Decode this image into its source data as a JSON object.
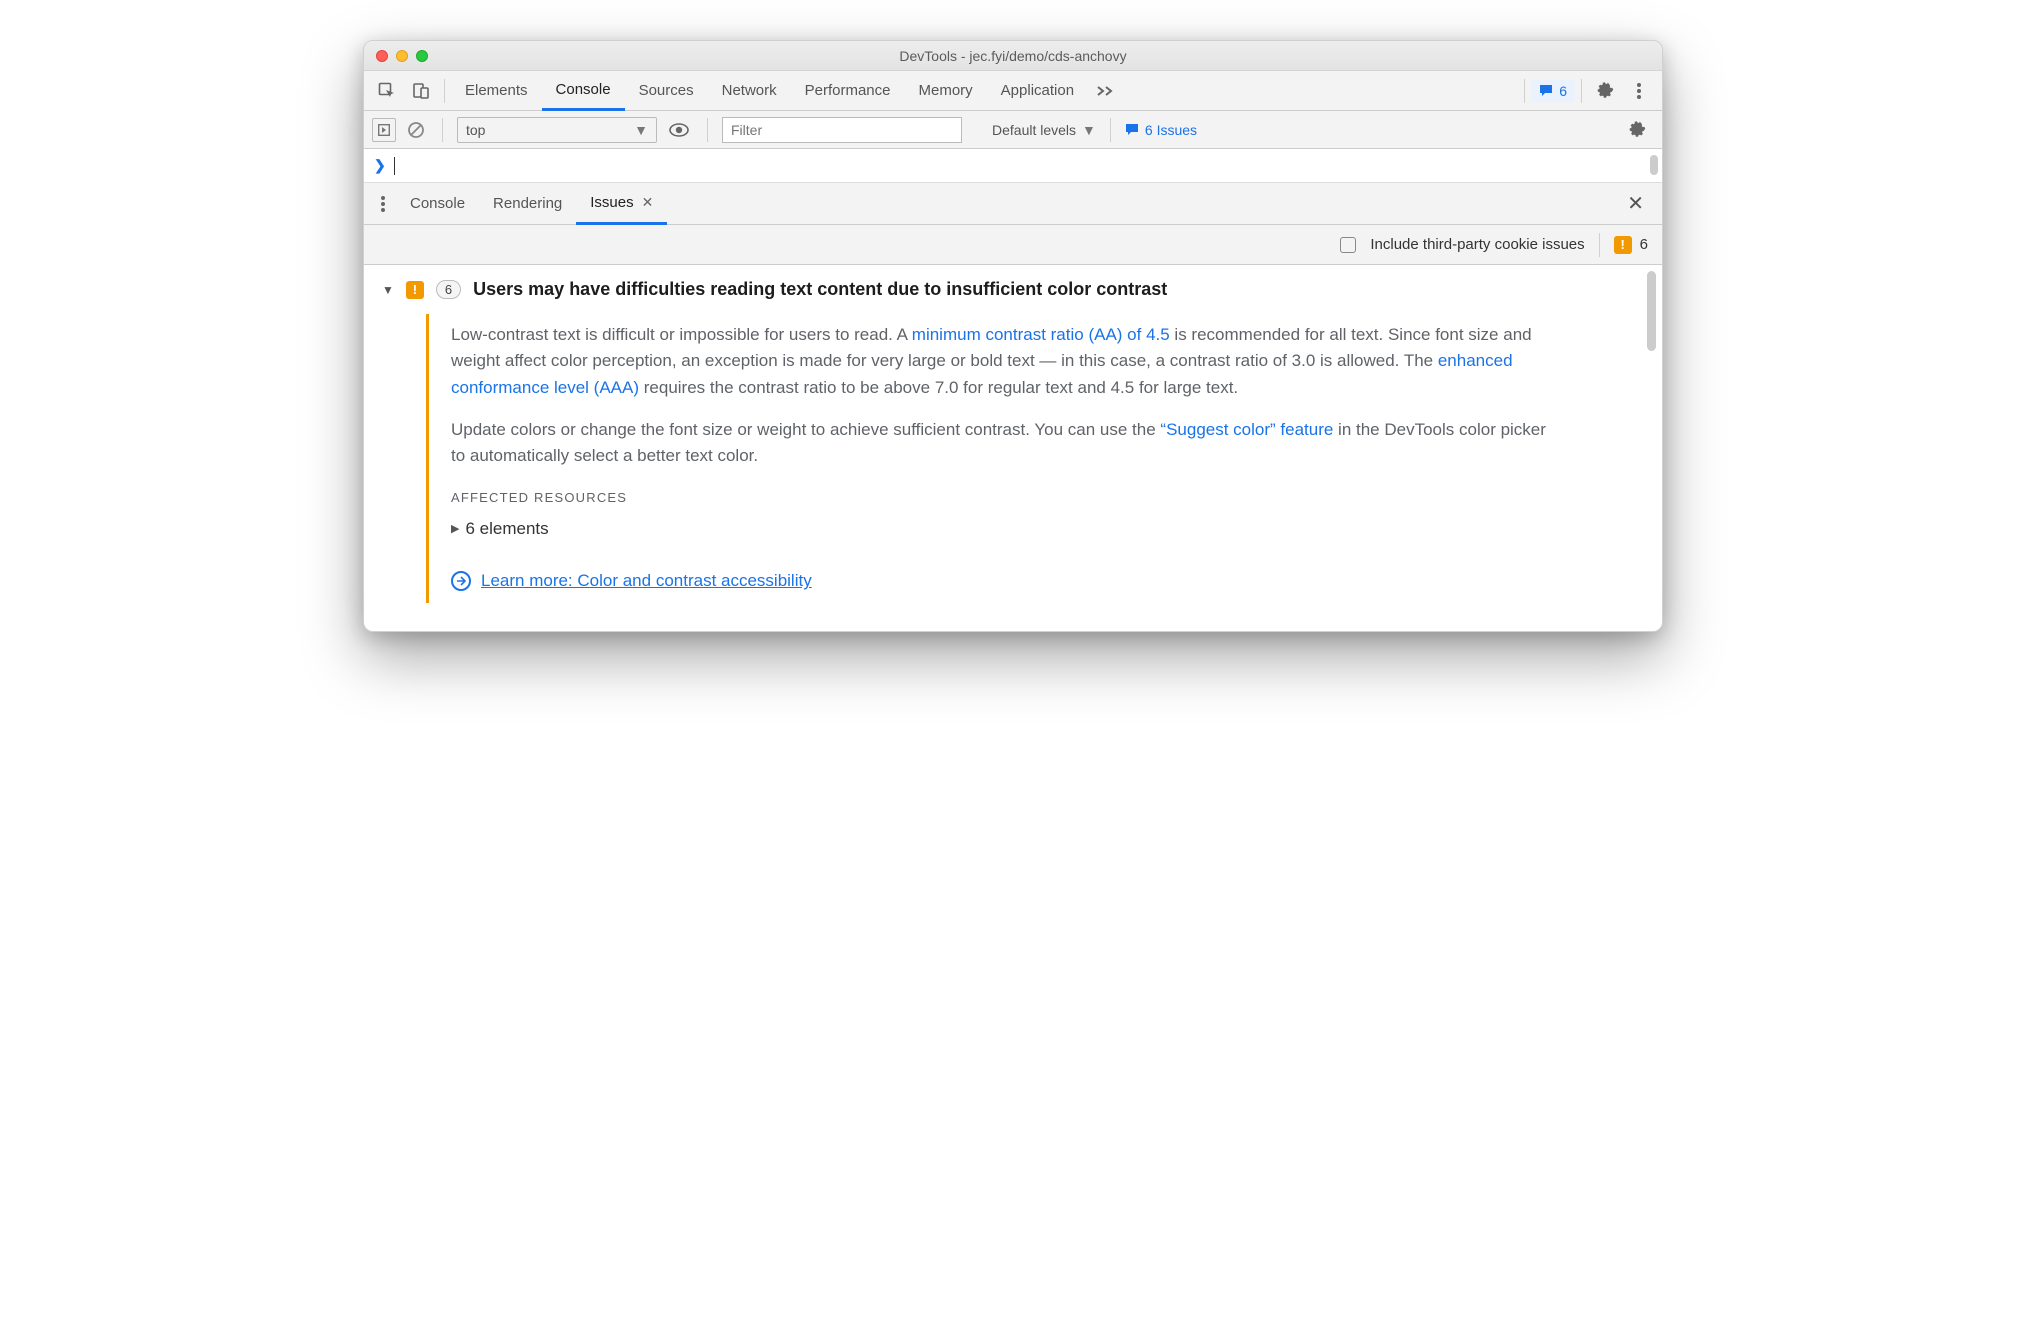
{
  "window": {
    "title": "DevTools - jec.fyi/demo/cds-anchovy"
  },
  "mainTabs": {
    "items": [
      "Elements",
      "Console",
      "Sources",
      "Network",
      "Performance",
      "Memory",
      "Application"
    ],
    "activeIndex": 1,
    "badgeCount": "6"
  },
  "consoleBar": {
    "context": "top",
    "filterPlaceholder": "Filter",
    "levels": "Default levels",
    "issuesLabel": "6 Issues"
  },
  "drawer": {
    "tabs": [
      "Console",
      "Rendering",
      "Issues"
    ],
    "activeIndex": 2
  },
  "optsBar": {
    "checkboxLabel": "Include third-party cookie issues",
    "count": "6"
  },
  "issue": {
    "count": "6",
    "title": "Users may have difficulties reading text content due to insufficient color contrast",
    "p1a": "Low-contrast text is difficult or impossible for users to read. A ",
    "link1": "minimum contrast ratio (AA) of 4.5",
    "p1b": " is recommended for all text. Since font size and weight affect color perception, an exception is made for very large or bold text — in this case, a contrast ratio of 3.0 is allowed. The ",
    "link2": "enhanced conformance level (AAA)",
    "p1c": " requires the contrast ratio to be above 7.0 for regular text and 4.5 for large text.",
    "p2a": "Update colors or change the font size or weight to achieve sufficient contrast. You can use the ",
    "link3": "“Suggest color” feature",
    "p2b": " in the DevTools color picker to automatically select a better text color.",
    "affectedLabel": "AFFECTED RESOURCES",
    "elementsLabel": "6 elements",
    "learnMore": "Learn more: Color and contrast accessibility"
  }
}
